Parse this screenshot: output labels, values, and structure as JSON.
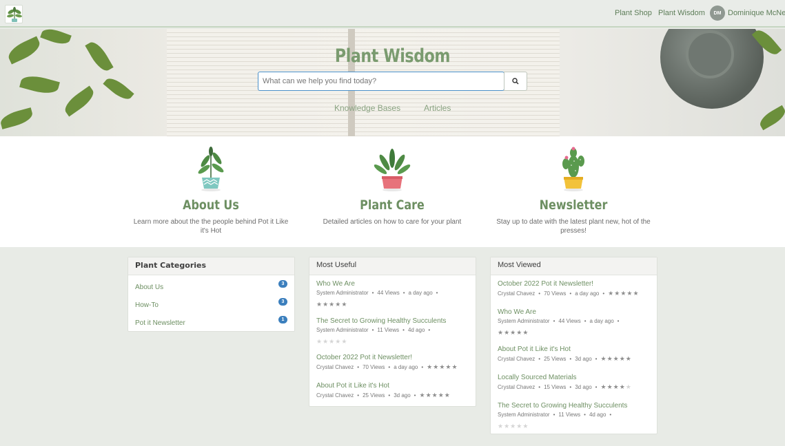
{
  "nav": {
    "links": [
      "Plant Shop",
      "Plant Wisdom"
    ],
    "user_initials": "DM",
    "user_name": "Dominique McNeil"
  },
  "hero": {
    "title": "Plant Wisdom",
    "search_placeholder": "What can we help you find today?",
    "links": [
      "Knowledge Bases",
      "Articles"
    ]
  },
  "features": [
    {
      "title": "About Us",
      "description": "Learn more about the the people behind Pot it Like it's Hot",
      "pot_color": "#7fc8c0"
    },
    {
      "title": "Plant Care",
      "description": "Detailed articles on how to care for your plant",
      "pot_color": "#e7727b"
    },
    {
      "title": "Newsletter",
      "description": "Stay up to date with the latest plant new, hot of the presses!",
      "pot_color": "#f2c23a"
    }
  ],
  "categories": {
    "title": "Plant Categories",
    "items": [
      {
        "label": "About Us",
        "count": "3"
      },
      {
        "label": "How-To",
        "count": "3"
      },
      {
        "label": "Pot it Newsletter",
        "count": "1"
      }
    ]
  },
  "most_useful": {
    "title": "Most Useful",
    "articles": [
      {
        "title": "Who We Are",
        "author": "System Administrator",
        "views": "44 Views",
        "age": "a day ago",
        "rating": 5,
        "stars_inline": false
      },
      {
        "title": "The Secret to Growing Healthy Succulents",
        "author": "System Administrator",
        "views": "11 Views",
        "age": "4d ago",
        "rating": 0,
        "stars_inline": false
      },
      {
        "title": "October 2022 Pot it Newsletter!",
        "author": "Crystal Chavez",
        "views": "70 Views",
        "age": "a day ago",
        "rating": 5,
        "stars_inline": true
      },
      {
        "title": "About Pot it Like it's Hot",
        "author": "Crystal Chavez",
        "views": "25 Views",
        "age": "3d ago",
        "rating": 5,
        "stars_inline": true
      }
    ]
  },
  "most_viewed": {
    "title": "Most Viewed",
    "articles": [
      {
        "title": "October 2022 Pot it Newsletter!",
        "author": "Crystal Chavez",
        "views": "70 Views",
        "age": "a day ago",
        "rating": 5,
        "stars_inline": true
      },
      {
        "title": "Who We Are",
        "author": "System Administrator",
        "views": "44 Views",
        "age": "a day ago",
        "rating": 5,
        "stars_inline": false
      },
      {
        "title": "About Pot it Like it's Hot",
        "author": "Crystal Chavez",
        "views": "25 Views",
        "age": "3d ago",
        "rating": 5,
        "stars_inline": true
      },
      {
        "title": "Locally Sourced Materials",
        "author": "Crystal Chavez",
        "views": "15 Views",
        "age": "3d ago",
        "rating": 4,
        "stars_inline": true
      },
      {
        "title": "The Secret to Growing Healthy Succulents",
        "author": "System Administrator",
        "views": "11 Views",
        "age": "4d ago",
        "rating": 0,
        "stars_inline": false
      }
    ]
  },
  "colors": {
    "accent_green": "#6d8f62",
    "badge_blue": "#3b7fbd",
    "star_filled": "#8e8e8e",
    "star_empty": "#d5d5d5"
  }
}
